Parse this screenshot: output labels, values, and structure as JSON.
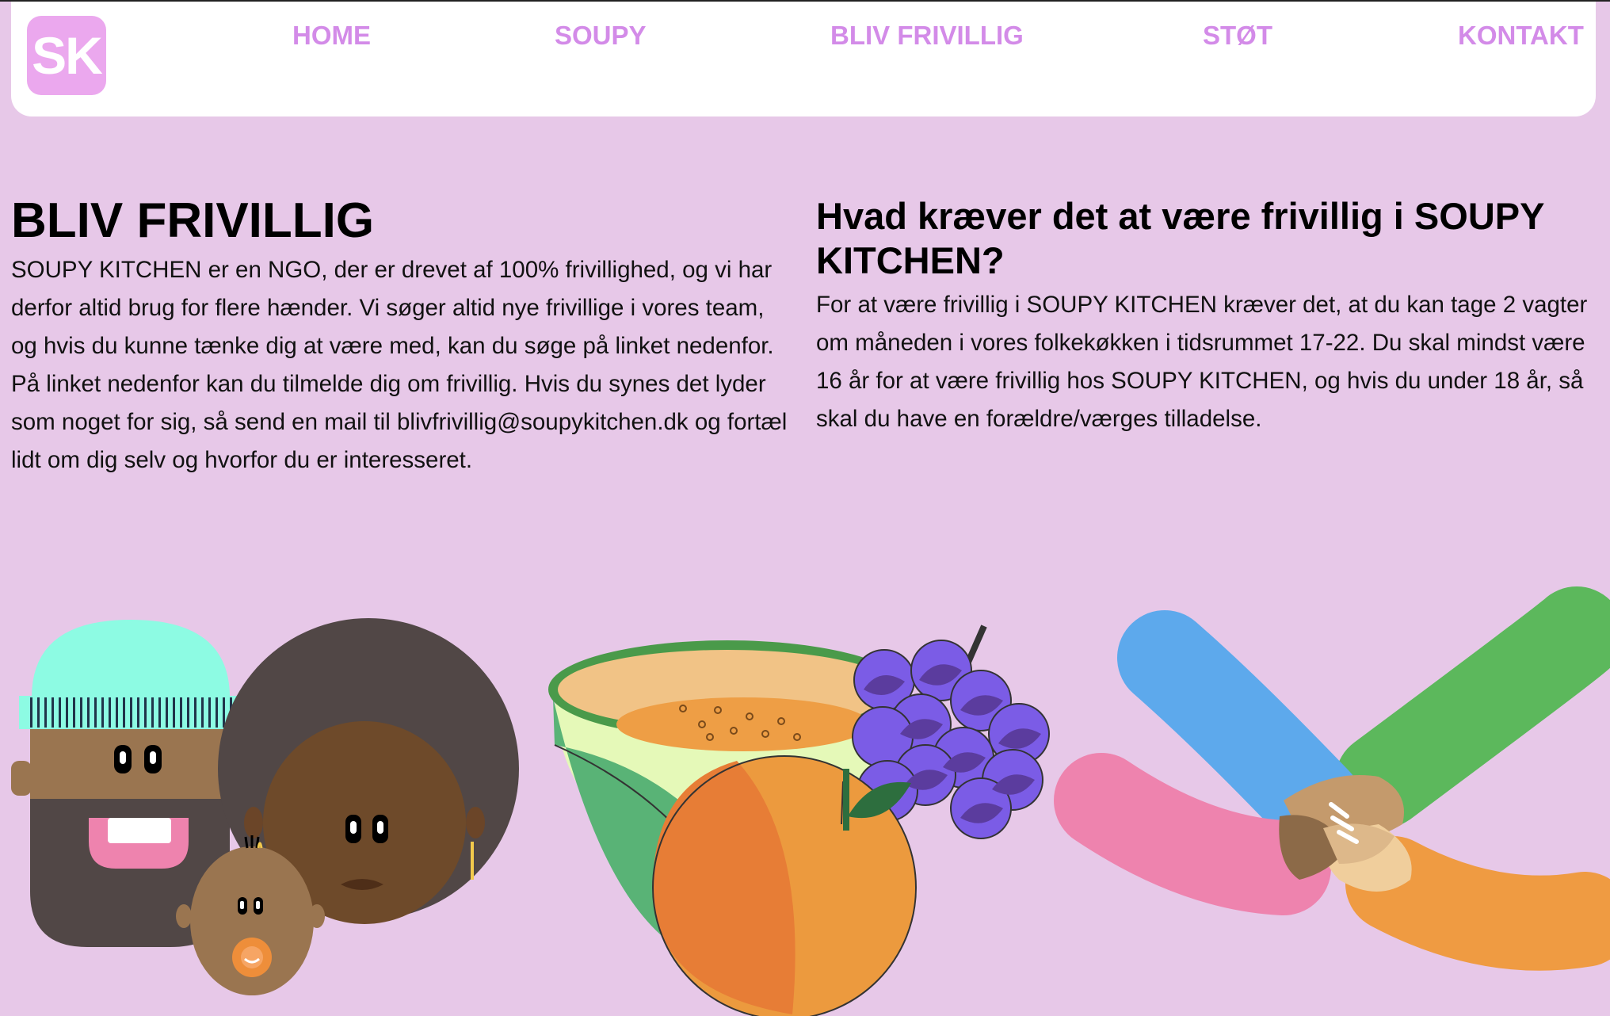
{
  "logo": {
    "text": "SK"
  },
  "nav": {
    "items": [
      {
        "label": "HOME"
      },
      {
        "label": "SOUPY"
      },
      {
        "label": "BLIV FRIVILLIG"
      },
      {
        "label": "STØT"
      },
      {
        "label": "KONTAKT"
      }
    ]
  },
  "main": {
    "title": "BLIV FRIVILLIG",
    "intro": "SOUPY KITCHEN er en NGO, der er drevet af 100% frivillighed, og vi har derfor altid brug for flere hænder. Vi søger altid nye frivillige i vores team, og hvis du kunne tænke dig at være med, kan du søge på linket nedenfor. På linket nedenfor kan du tilmelde dig om frivillig. Hvis du synes det lyder som noget for sig, så send en mail til blivfrivillig@soupykitchen.dk og fortæl lidt om dig selv og hvorfor du er interesseret."
  },
  "requirements": {
    "heading": "Hvad kræver det at være frivillig i SOUPY KITCHEN?",
    "text": "For at være frivillig i SOUPY KITCHEN kræver det, at du kan tage 2 vagter om måneden i vores folkekøkken i tidsrummet 17-22. Du skal mindst være 16 år for at være frivillig hos SOUPY KITCHEN, og hvis du under 18 år, så skal du have en forældre/værges tilladelse."
  },
  "illustrations": {
    "people": "family-illustration",
    "fruit": "fruit-illustration",
    "hands": "hands-together-illustration"
  },
  "colors": {
    "background": "#E7C8E8",
    "nav_link": "#D38BE8",
    "logo_bg": "#EBA8EE"
  }
}
